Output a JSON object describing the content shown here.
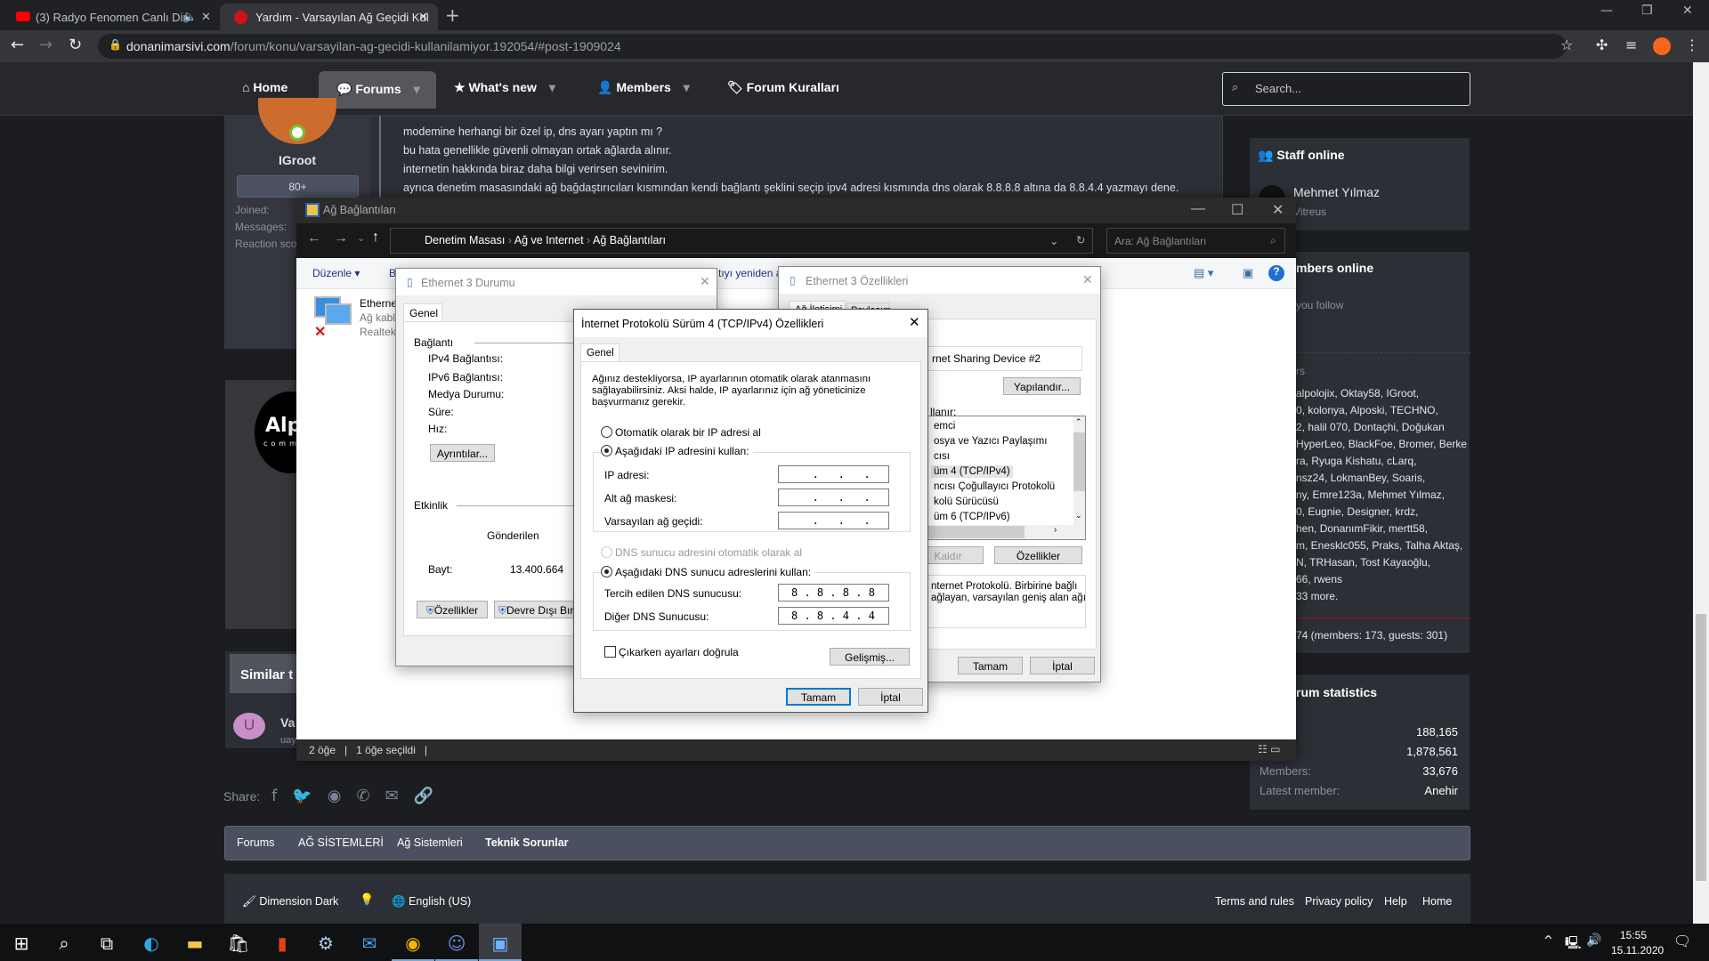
{
  "browser": {
    "tabs": [
      {
        "title": "(3) Radyo Fenomen Canlı Din",
        "icon": "youtube-icon",
        "audio": true
      },
      {
        "title": "Yardım - Varsayılan Ağ Geçidi Kul",
        "icon": "donanimarsivi-icon",
        "active": true
      }
    ],
    "url_domain": "donanimarsivi.com",
    "url_path": "/forum/konu/varsayilan-ag-gecidi-kullanilamiyor.192054/#post-1909024"
  },
  "forum": {
    "nav": [
      {
        "label": "Home"
      },
      {
        "label": "Forums",
        "active": true
      },
      {
        "label": "What's new"
      },
      {
        "label": "Members"
      },
      {
        "label": "Forum Kuralları"
      }
    ],
    "search_placeholder": "Search...",
    "user": {
      "name": "IGroot",
      "badge": "80+",
      "joined": "Joined:",
      "messages": "Messages:",
      "reaction": "Reaction sco"
    },
    "post_lines": [
      "modemine herhangi bir özel ip, dns ayarı yaptın mı ?",
      "bu hata genellikle güvenli olmayan ortak ağlarda alınır.",
      "internetin hakkında biraz daha bilgi verirsen sevinirim.",
      "ayrıca denetim masasındaki ağ bağdaştırıcıları kısmından kendi bağlantı şeklini seçip ipv4 adresi kısmında dns olarak 8.8.8.8 altına da 8.8.4.4 yazmayı dene."
    ],
    "sig_logo": "Alp",
    "sig_logo_sub": "comm",
    "similar_title": "Similar t",
    "similar_item": "Va",
    "similar_sub": "uay",
    "similar_avatar": "U",
    "staff": {
      "title": "Staff online",
      "name": "Mehmet Yılmaz",
      "role": "Vitreus"
    },
    "members_online": {
      "title": "mbers online",
      "follow": "you follow",
      "sub": "rs",
      "lines": [
        "alpolojix, Oktay58, IGroot,",
        "0, kolonya, Alposki, TECHNO,",
        "2, halil 070, Dontaçhi, Doğukan",
        "HyperLeo, BlackFoe, Bromer, Berke",
        "ra, Ryuga Kishatu, cLarq,",
        "nsz24, LokmanBey, Soaris,",
        "ny, Emre123a, Mehmet Yılmaz,",
        "0, Eugnie, Designer, krdz,",
        "hen, DonanımFikir, mertt58,",
        "m, Enesklc055, Praks, Talha Aktaş,",
        "N, TRHasan, Tost Kayaoğlu,",
        "66, rwens",
        "33 more."
      ],
      "total": "74 (members: 173, guests: 301)"
    },
    "stats": {
      "title": "rum statistics",
      "rows": [
        {
          "k": "s:",
          "v": "188,165"
        },
        {
          "k": "ges:",
          "v": "1,878,561"
        },
        {
          "k": "Members:",
          "v": "33,676"
        },
        {
          "k": "Latest member:",
          "v": "Anehir"
        }
      ]
    },
    "share_label": "Share:",
    "breadcrumb": [
      "Forums",
      "AĞ SİSTEMLERİ",
      "Ağ Sistemleri",
      "Teknik Sorunlar"
    ],
    "footer": {
      "style": "Dimension Dark",
      "language": "English (US)",
      "links": [
        "Terms and rules",
        "Privacy policy",
        "Help",
        "Home"
      ]
    }
  },
  "explorer": {
    "title": "Ağ Bağlantıları",
    "path": [
      "Denetim Masası",
      "Ağ ve Internet",
      "Ağ Bağlantıları"
    ],
    "search_placeholder": "Ara: Ağ Bağlantıları",
    "toolbar": {
      "organize": "Düzenle",
      "frag1": "B",
      "frag2": "tıyı yeniden a"
    },
    "item": {
      "name": "Etherne",
      "status": "Ağ kabl",
      "device": "Realtek"
    },
    "status": {
      "count": "2 öğe",
      "selected": "1 öğe seçildi"
    }
  },
  "status_dialog": {
    "title": "Ethernet 3 Durumu",
    "tab": "Genel",
    "section_conn": "Bağlantı",
    "rows": [
      "IPv4 Bağlantısı:",
      "IPv6 Bağlantısı:",
      "Medya Durumu:",
      "Süre:",
      "Hız:"
    ],
    "details": "Ayrıntılar...",
    "section_act": "Etkinlik",
    "sent": "Gönderilen",
    "bytes_label": "Bayt:",
    "bytes_value": "13.400.664",
    "props": "Özellikler",
    "disable": "Devre Dışı Bıra"
  },
  "props_dialog": {
    "title": "Ethernet 3 Özellikleri",
    "tabs": [
      "Ağ İletişimi",
      "Paylaşım"
    ],
    "device": "rnet Sharing Device #2",
    "configure": "Yapılandır...",
    "uses": "llanır:",
    "items": [
      "emci",
      "osya ve Yazıcı Paylaşımı",
      "cısı",
      "üm 4 (TCP/IPv4)",
      "ncısı Çoğullayıcı Protokolü",
      "kolü Sürücüsü",
      "üm 6 (TCP/IPv6)"
    ],
    "uninstall": "Kaldır",
    "properties": "Özellikler",
    "desc1": "nternet Protokolü. Birbirine bağlı",
    "desc2": "ağlayan, varsayılan geniş alan ağı",
    "ok": "Tamam",
    "cancel": "İptal"
  },
  "ipv4_dialog": {
    "title": "İnternet Protokolü Sürüm 4 (TCP/IPv4) Özellikleri",
    "tab": "Genel",
    "intro": "Ağınız destekliyorsa, IP ayarlarının otomatik olarak atanmasını sağlayabilirsiniz. Aksi halde, IP ayarlarınız için ağ yöneticinize başvurmanız gerekir.",
    "auto_ip": "Otomatik olarak bir IP adresi al",
    "manual_ip": "Aşağıdaki IP adresini kullan:",
    "ip_label": "IP adresi:",
    "mask_label": "Alt ağ maskesi:",
    "gateway_label": "Varsayılan ağ geçidi:",
    "ip_value": "   .   .   .   ",
    "mask_value": "   .   .   .   ",
    "gateway_value": "   .   .   .   ",
    "auto_dns": "DNS sunucu adresini otomatik olarak al",
    "manual_dns": "Aşağıdaki DNS sunucu adreslerini kullan:",
    "pref_dns_label": "Tercih edilen DNS sunucusu:",
    "pref_dns": "8 . 8 . 8 . 8",
    "alt_dns_label": "Diğer DNS Sunucusu:",
    "alt_dns": "8 . 8 . 4 . 4",
    "validate": "Çıkarken ayarları doğrula",
    "validate_checked": false,
    "advanced": "Gelişmiş...",
    "ok": "Tamam",
    "cancel": "İptal",
    "selected_ip_mode": "manual",
    "selected_dns_mode": "manual"
  },
  "taskbar": {
    "time": "15:55",
    "date": "15.11.2020"
  }
}
